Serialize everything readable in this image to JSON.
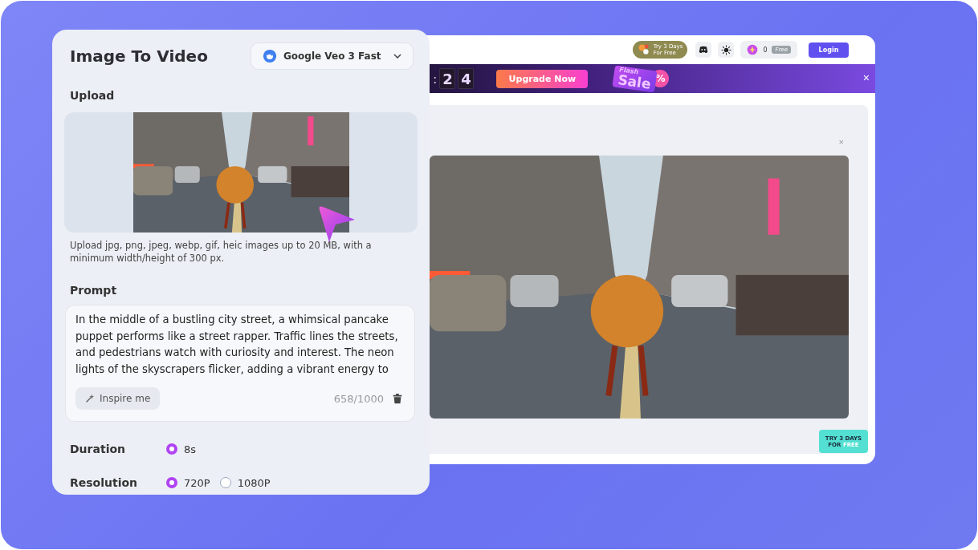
{
  "panel": {
    "title": "Image To Video",
    "model_select": {
      "value": "Google Veo 3 Fast"
    },
    "upload": {
      "label": "Upload",
      "hint": "Upload jpg, png, jpeg, webp, gif, heic images up to 20 MB, with a minimum width/height of 300 px."
    },
    "prompt": {
      "label": "Prompt",
      "value": "In the middle of a bustling city street, a whimsical pancake puppet performs like a street rapper. Traffic lines the streets, and pedestrians watch with curiosity and interest. The neon lights of the skyscrapers flicker, adding a vibrant energy to",
      "inspire_button": "Inspire me",
      "counter": "658/1000"
    },
    "options": [
      {
        "label": "Duration",
        "choices": [
          {
            "label": "8s",
            "selected": true
          }
        ]
      },
      {
        "label": "Resolution",
        "choices": [
          {
            "label": "720P",
            "selected": true
          },
          {
            "label": "1080P",
            "selected": false
          }
        ]
      }
    ]
  },
  "browser": {
    "header": {
      "trial_pill": {
        "line1": "Try 3 Days",
        "line2": "For Free"
      },
      "credits": "0",
      "plan_tag": "Free",
      "login_button": "Login"
    },
    "banner": {
      "countdown": {
        "separator": ":",
        "digits": [
          "2",
          "4"
        ]
      },
      "upgrade_button": "Upgrade Now",
      "sale_art": {
        "line1": "Flash",
        "line2": "Sale",
        "badge": "%"
      },
      "close": "×"
    },
    "preview": {
      "close": "×"
    },
    "gift_badge": {
      "line1": "TRY 3 DAYS",
      "line2a": "FOR",
      "line2b": "FREE"
    }
  }
}
